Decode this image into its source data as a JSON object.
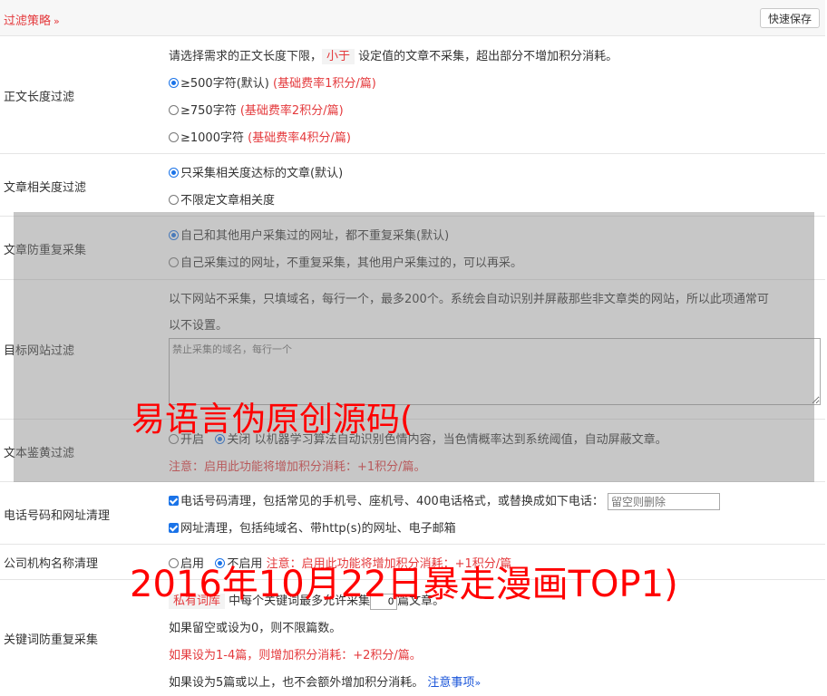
{
  "header": {
    "title": "过滤策略",
    "chevron": "»",
    "save_label": "快速保存"
  },
  "length_filter": {
    "label": "正文长度过滤",
    "desc_prefix": "请选择需求的正文长度下限，",
    "desc_highlight": "小于",
    "desc_suffix": "设定值的文章不采集，超出部分不增加积分消耗。",
    "options": [
      {
        "text": "≥500字符(默认)",
        "note": "(基础费率1积分/篇)",
        "selected": true
      },
      {
        "text": "≥750字符",
        "note": "(基础费率2积分/篇)",
        "selected": false
      },
      {
        "text": "≥1000字符",
        "note": "(基础费率4积分/篇)",
        "selected": false
      }
    ]
  },
  "relevance_filter": {
    "label": "文章相关度过滤",
    "options": [
      {
        "text": "只采集相关度达标的文章(默认)",
        "selected": true
      },
      {
        "text": "不限定文章相关度",
        "selected": false
      }
    ]
  },
  "dedupe": {
    "label": "文章防重复采集",
    "options": [
      {
        "text": "自己和其他用户采集过的网址，都不重复采集(默认)",
        "selected": true
      },
      {
        "text": "自己采集过的网址，不重复采集，其他用户采集过的，可以再采。",
        "selected": false
      }
    ]
  },
  "site_filter": {
    "label": "目标网站过滤",
    "desc_line1": "以下网站不采集，只填域名，每行一个，最多200个。系统会自动识别并屏蔽那些非文章类的网站，所以此项通常可",
    "desc_line2": "以不设置。",
    "placeholder": "禁止采集的域名，每行一个"
  },
  "porn_filter": {
    "label": "文本鉴黄过滤",
    "on_label": "开启",
    "off_label": "关闭",
    "off_selected": true,
    "desc": "以机器学习算法自动识别色情内容，当色情概率达到系统阈值，自动屏蔽文章。",
    "note": "注意：启用此功能将增加积分消耗：+1积分/篇。"
  },
  "phone_clean": {
    "label": "电话号码和网址清理",
    "phone_text": "电话号码清理，包括常见的手机号、座机号、400电话格式，或替换成如下电话：",
    "phone_placeholder": "留空则删除",
    "url_text": "网址清理，包括纯域名、带http(s)的网址、电子邮箱"
  },
  "org_clean": {
    "label": "公司机构名称清理",
    "on_label": "启用",
    "off_label": "不启用",
    "note": "注意：启用此功能将增加积分消耗：+1积分/篇"
  },
  "keyword_dedupe": {
    "label": "关键词防重复采集",
    "tag": "私有词库",
    "text_a": "中每个关键词最多允许采集",
    "value": "0",
    "text_b": "篇文章。",
    "line2": "如果留空或设为0，则不限篇数。",
    "line3": "如果设为1-4篇，则增加积分消耗：+2积分/篇。",
    "line4": "如果设为5篇或以上，也不会额外增加积分消耗。",
    "link": "注意事项",
    "link_chev": "»"
  },
  "watermarks": {
    "line1": "易语言伪原创源码(",
    "line2": "2016年10月22日暴走漫画TOP1)"
  },
  "colors": {
    "accent_red": "#e4393c",
    "radio_blue": "#1a73e8",
    "link_blue": "#1a55d9"
  }
}
